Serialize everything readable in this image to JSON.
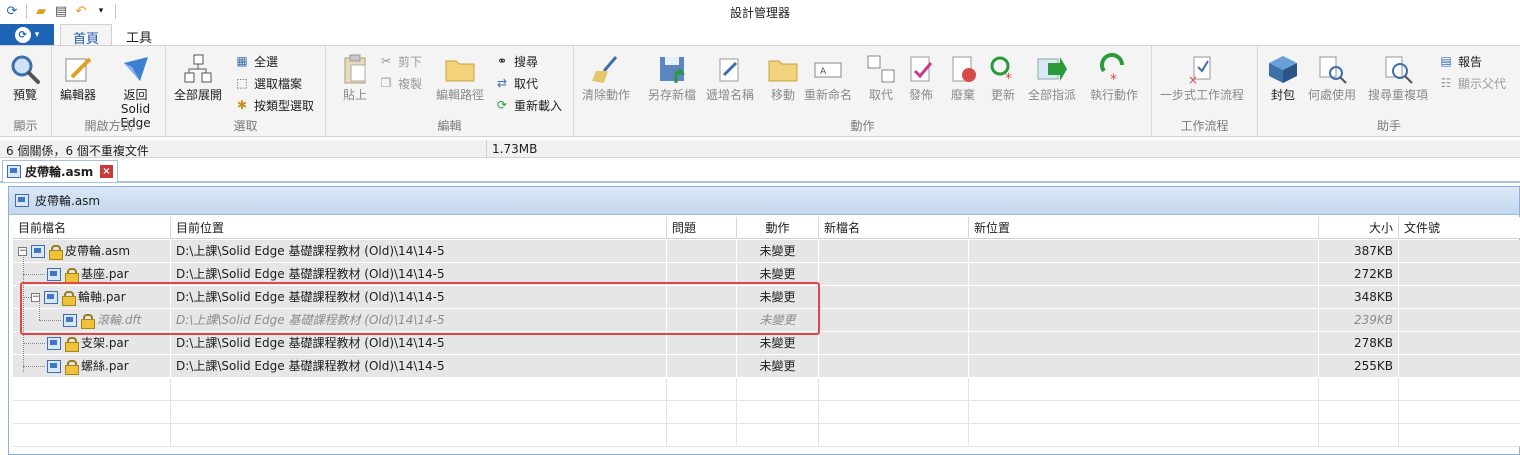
{
  "window": {
    "title": "設計管理器"
  },
  "quick_access": {
    "icons": [
      "app-icon",
      "open-folder-icon",
      "print-icon",
      "undo-icon",
      "dropdown-icon"
    ]
  },
  "tabs": [
    {
      "label": "首頁"
    },
    {
      "label": "工具"
    }
  ],
  "ribbon": {
    "groups": {
      "display": "顯示",
      "open_with": "開啟方式",
      "select": "選取",
      "edit": "編輯",
      "action": "動作",
      "workflow": "工作流程",
      "assistant": "助手"
    },
    "buttons": {
      "preview": "預覽",
      "editor": "編輯器",
      "return_line1": "返回",
      "return_line2": "Solid Edge",
      "expand_all": "全部展開",
      "select_all": "全選",
      "select_files": "選取檔案",
      "select_by_type": "按類型選取",
      "paste": "貼上",
      "cut": "剪下",
      "copy": "複製",
      "edit_path": "編輯路徑",
      "search": "搜尋",
      "replace": "取代",
      "reload": "重新載入",
      "clear_action": "清除動作",
      "save_as": "另存新檔",
      "increment_name": "遞增名稱",
      "move": "移動",
      "rename": "重新命名",
      "replace_action": "取代",
      "publish": "發佈",
      "obsolete": "廢棄",
      "update": "更新",
      "assign_all": "全部指派",
      "execute_action": "執行動作",
      "one_step_workflow": "一步式工作流程",
      "pack": "封包",
      "where_used": "何處使用",
      "find_duplicates": "搜尋重複項",
      "report": "報告",
      "show_parent": "顯示父代"
    }
  },
  "status": {
    "summary": "6 個關係，6 個不重複文件",
    "size": "1.73MB"
  },
  "document_tab": {
    "label": "皮帶輪.asm"
  },
  "panel": {
    "title": "皮帶輪.asm"
  },
  "table": {
    "columns": [
      "目前檔名",
      "目前位置",
      "問題",
      "動作",
      "新檔名",
      "新位置",
      "大小",
      "文件號"
    ],
    "rows": [
      {
        "name": "皮帶輪.asm",
        "location": "D:\\上課\\Solid Edge 基礎課程教材 (Old)\\14\\14-5",
        "issue": "",
        "action": "未變更",
        "new_name": "",
        "new_location": "",
        "size": "387KB",
        "doc_no": ""
      },
      {
        "name": "基座.par",
        "location": "D:\\上課\\Solid Edge 基礎課程教材 (Old)\\14\\14-5",
        "issue": "",
        "action": "未變更",
        "new_name": "",
        "new_location": "",
        "size": "272KB",
        "doc_no": ""
      },
      {
        "name": "輪軸.par",
        "location": "D:\\上課\\Solid Edge 基礎課程教材 (Old)\\14\\14-5",
        "issue": "",
        "action": "未變更",
        "new_name": "",
        "new_location": "",
        "size": "348KB",
        "doc_no": ""
      },
      {
        "name": "滾輪.dft",
        "location": "D:\\上課\\Solid Edge 基礎課程教材 (Old)\\14\\14-5",
        "issue": "",
        "action": "未變更",
        "new_name": "",
        "new_location": "",
        "size": "239KB",
        "doc_no": ""
      },
      {
        "name": "支架.par",
        "location": "D:\\上課\\Solid Edge 基礎課程教材 (Old)\\14\\14-5",
        "issue": "",
        "action": "未變更",
        "new_name": "",
        "new_location": "",
        "size": "278KB",
        "doc_no": ""
      },
      {
        "name": "螺絲.par",
        "location": "D:\\上課\\Solid Edge 基礎課程教材 (Old)\\14\\14-5",
        "issue": "",
        "action": "未變更",
        "new_name": "",
        "new_location": "",
        "size": "255KB",
        "doc_no": ""
      }
    ]
  },
  "colors": {
    "accent": "#1e64b4",
    "highlight": "#e04848",
    "row_bg": "#e6e6e6"
  }
}
